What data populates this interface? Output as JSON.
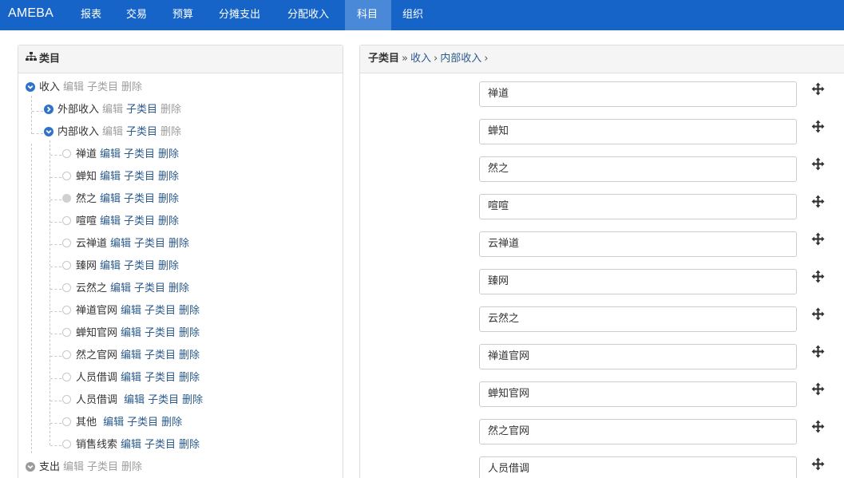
{
  "nav": {
    "brand": "AMEBA",
    "items": [
      "报表",
      "交易",
      "预算",
      "分摊支出",
      "分配收入",
      "科目",
      "组织"
    ],
    "active_index": 5
  },
  "left": {
    "title": "类目",
    "actions": {
      "edit": "编辑",
      "sub": "子类目",
      "delete": "删除"
    },
    "tree": {
      "income": "收入",
      "external": "外部收入",
      "internal": "内部收入",
      "children": [
        "禅道",
        "蝉知",
        "然之",
        "喧喧",
        "云禅道",
        "臻网",
        "云然之",
        "禅道官网",
        "蝉知官网",
        "然之官网",
        "人员借调",
        "人员借调 ",
        "其他 ",
        "销售线索"
      ],
      "expense": "支出"
    }
  },
  "right": {
    "breadcrumb": {
      "title": "子类目",
      "sep": "»",
      "level1": "收入",
      "arrow": "›",
      "level2": "内部收入"
    },
    "fields": [
      "禅道",
      "蝉知",
      "然之",
      "喧喧",
      "云禅道",
      "臻网",
      "云然之",
      "禅道官网",
      "蝉知官网",
      "然之官网",
      "人员借调"
    ]
  },
  "colors": {
    "navbar": "#1764c8",
    "nav_active": "#4a89d8",
    "link": "#2a5a8c",
    "muted": "#9e9e9e"
  }
}
